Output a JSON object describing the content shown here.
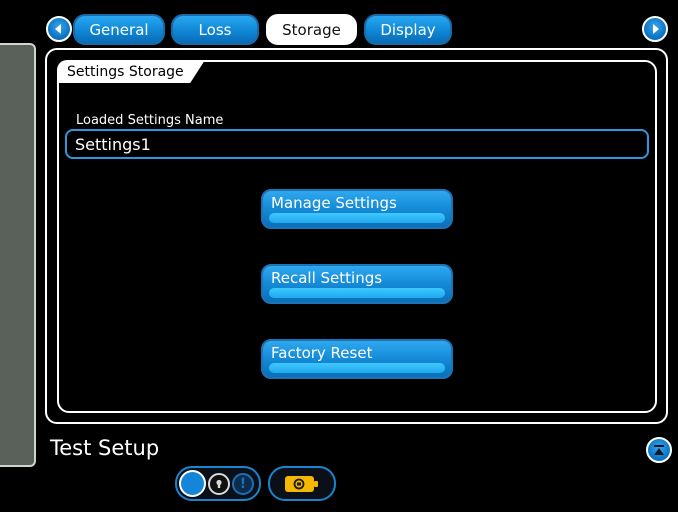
{
  "tabs": [
    {
      "label": "General",
      "active": false
    },
    {
      "label": "Loss",
      "active": false
    },
    {
      "label": "Storage",
      "active": true
    },
    {
      "label": "Display",
      "active": false
    }
  ],
  "nav": {
    "prev_icon": "chevron-left-icon",
    "next_icon": "chevron-right-icon"
  },
  "panel": {
    "section_title": "Settings Storage",
    "field_label": "Loaded Settings Name",
    "field_value": "Settings1",
    "buttons": {
      "manage": "Manage Settings",
      "recall": "Recall Settings",
      "factory": "Factory Reset"
    }
  },
  "footer": {
    "title": "Test Setup",
    "collapse_icon": "collapse-up-icon"
  },
  "status": {
    "indicator_icon": "status-dot-icon",
    "lock_icon": "lock-icon",
    "warning_icon": "warning-icon",
    "battery_icon": "battery-icon"
  },
  "colors": {
    "accent": "#148ad7",
    "background": "#000000",
    "battery": "#f5b800"
  }
}
